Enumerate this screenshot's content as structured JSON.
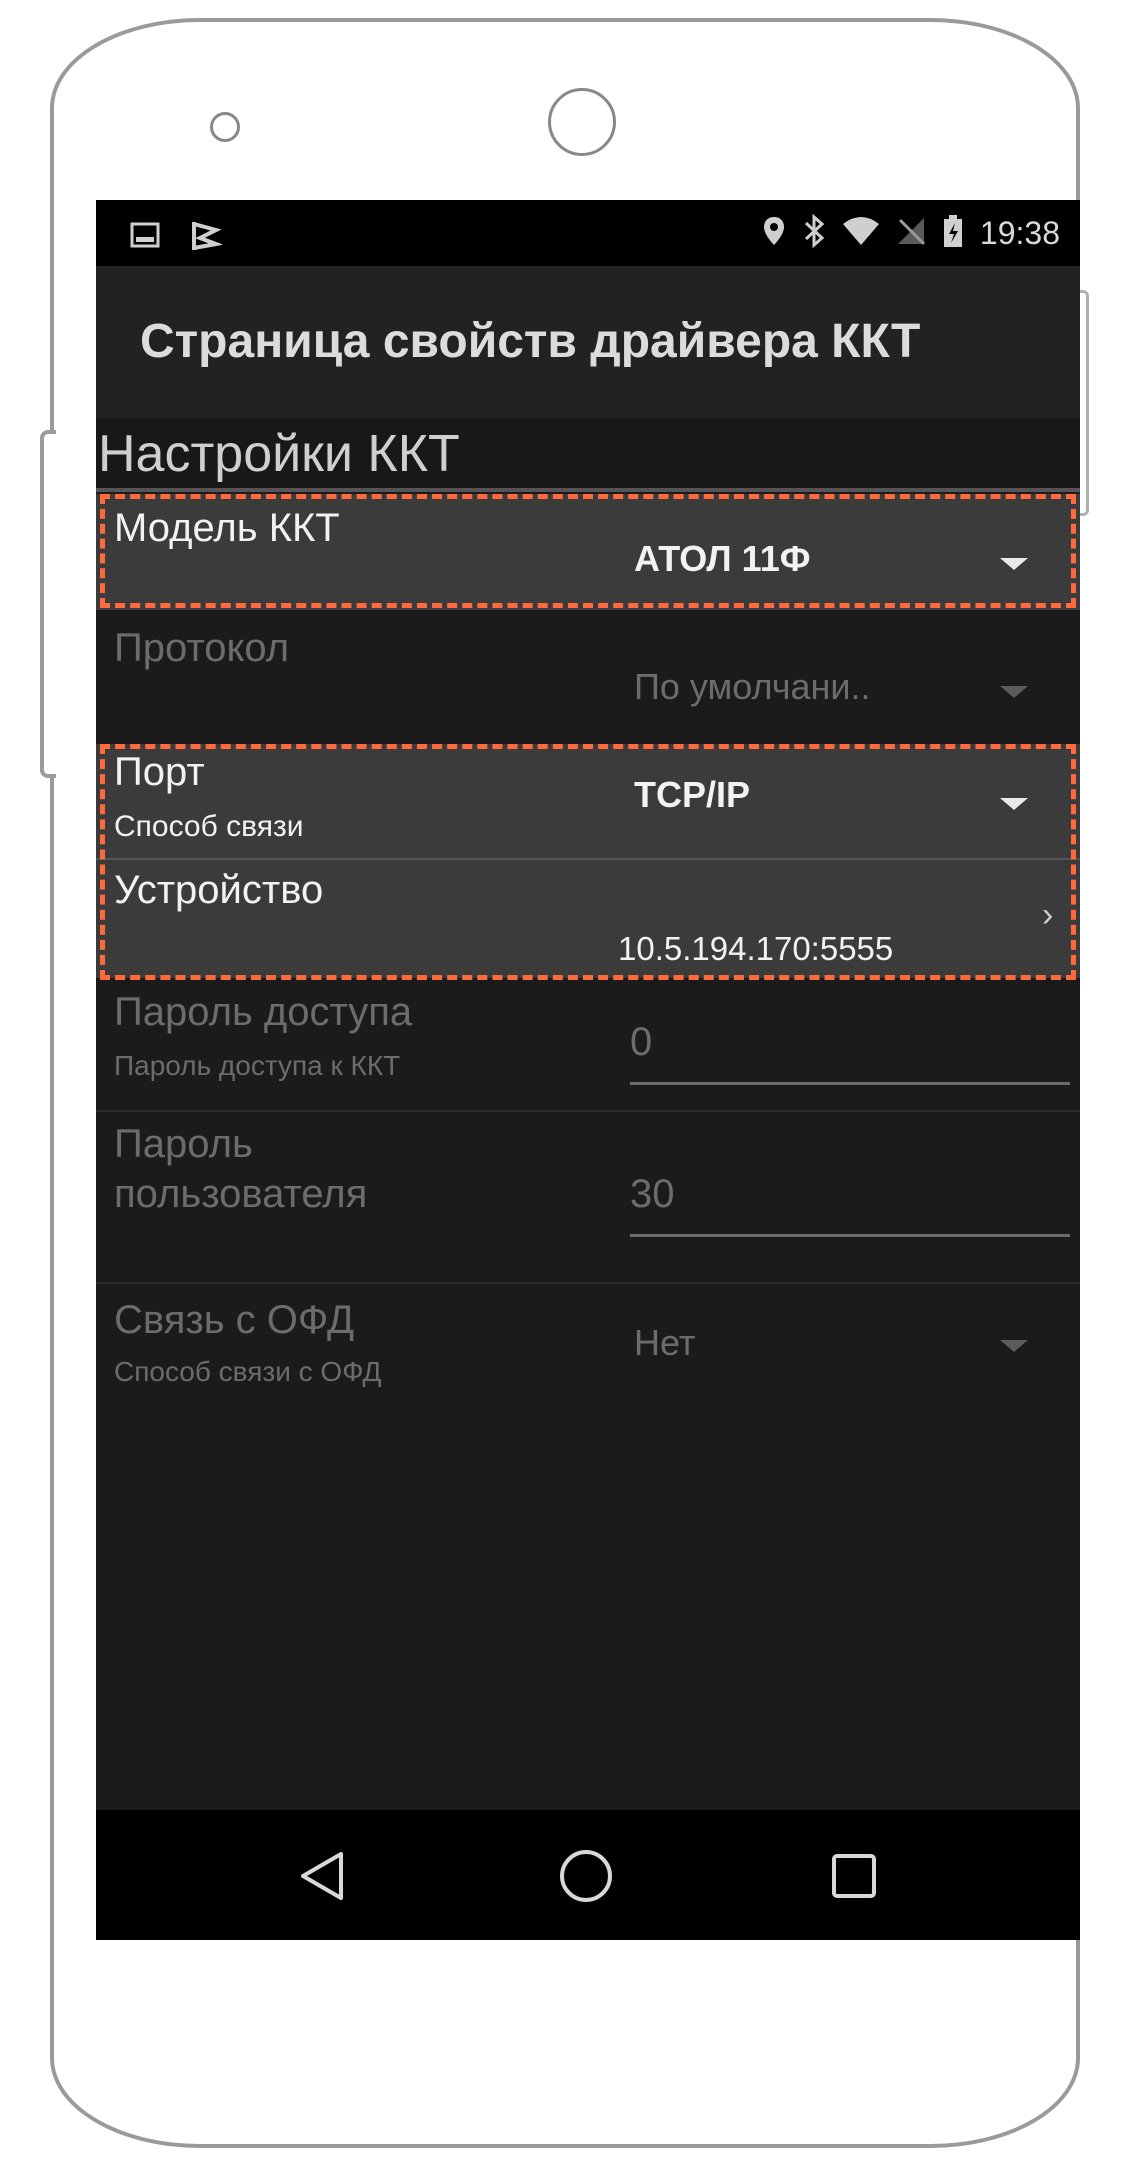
{
  "status_bar": {
    "time": "19:38",
    "left_icons": [
      "image-icon",
      "flag-icon"
    ],
    "right_icons": [
      "location-icon",
      "bluetooth-icon",
      "wifi-icon",
      "no-sim-icon",
      "battery-charging-icon"
    ]
  },
  "action_bar": {
    "title": "Страница свойств драйвера ККТ"
  },
  "category": {
    "title": "Настройки ККТ"
  },
  "settings": [
    {
      "title": "Модель ККТ",
      "value": "АТОЛ 11Ф",
      "summary": "",
      "state": "active"
    },
    {
      "title": "Протокол",
      "value": "По умолчани..",
      "summary": "",
      "state": "disabled"
    },
    {
      "title": "Порт",
      "summary": "Способ связи",
      "value": "TCP/IP",
      "state": "active"
    },
    {
      "title": "Устройство",
      "summary": "",
      "value": "10.5.194.170:5555",
      "state": "active"
    },
    {
      "title": "Пароль доступа",
      "summary": "Пароль доступа к ККТ",
      "value": "0",
      "state": "disabled"
    },
    {
      "title_line1": "Пароль",
      "title_line2": "пользователя",
      "value": "30",
      "state": "disabled"
    },
    {
      "title": "Связь с ОФД",
      "summary": "Способ связи с ОФД",
      "value": "Нет",
      "state": "disabled"
    }
  ],
  "navigation": {
    "buttons": [
      "back-icon",
      "home-icon",
      "recents-icon"
    ]
  },
  "colors": {
    "highlight": "#ff6a3d",
    "screen_background": "#1b1b1b",
    "active_row": "#3b3b3b"
  }
}
